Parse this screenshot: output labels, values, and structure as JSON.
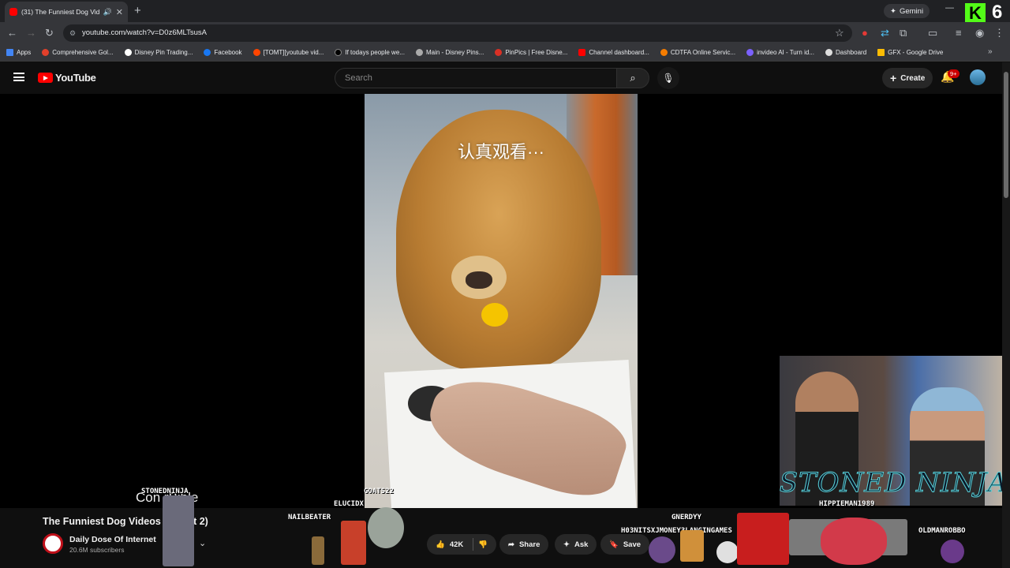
{
  "browser": {
    "tab_title": "(31) The Funniest Dog Vide",
    "url": "youtube.com/watch?v=D0z6MLTsusA",
    "gemini_label": "Gemini",
    "kick_letter": "K",
    "kick_number": "6",
    "bookmarks": [
      {
        "label": "Apps",
        "color": "#4285f4"
      },
      {
        "label": "Comprehensive Gol...",
        "color": "#e2402b"
      },
      {
        "label": "Disney Pin Trading...",
        "color": "#ffffff"
      },
      {
        "label": "Facebook",
        "color": "#1877f2"
      },
      {
        "label": "[TOMT][youtube vid...",
        "color": "#ff4500"
      },
      {
        "label": "If todays people we...",
        "color": "#000000"
      },
      {
        "label": "Main - Disney Pins...",
        "color": "#aaaaaa"
      },
      {
        "label": "PinPics | Free Disne...",
        "color": "#d93025"
      },
      {
        "label": "Channel dashboard...",
        "color": "#ff0000"
      },
      {
        "label": "CDTFA Online Servic...",
        "color": "#f57c00"
      },
      {
        "label": "invideo AI - Turn id...",
        "color": "#7b61ff"
      },
      {
        "label": "Dashboard",
        "color": "#dddddd"
      },
      {
        "label": "GFX - Google Drive",
        "color": "#fbbc04"
      }
    ]
  },
  "youtube": {
    "logo_text": "YouTube",
    "search_placeholder": "Search",
    "create_label": "Create",
    "notification_badge": "9+"
  },
  "video": {
    "caption": "认真观看···",
    "title": "The Funniest Dog Videos ",
    "title_tail": "art 2)",
    "channel_name": "Daily Dose Of Internet",
    "subscribers": "20.6M subscribers",
    "like_count": "42K",
    "share_label": "Share",
    "ask_label": "Ask",
    "save_label": "Save"
  },
  "overlay": {
    "brand": "STONED NINJA",
    "sub_text": "Con   rBible",
    "chat_names": {
      "stonedninja": "STONEDNINJA",
      "goats22": "GOATS22",
      "elucidx": "ELUCIDX",
      "nailbeater": "NAILBEATER",
      "gnerdyy": "GNERDYY",
      "h03nits": "H03NITSXJMONEY3LANGINGAMES",
      "hippieman": "HIPPIEMAN1989",
      "oldman": "OLDMANROBBO"
    }
  },
  "colors": {
    "accent": "#ff0000",
    "kick_green": "#53fc18",
    "ninja_cyan": "#5ad1d8"
  }
}
